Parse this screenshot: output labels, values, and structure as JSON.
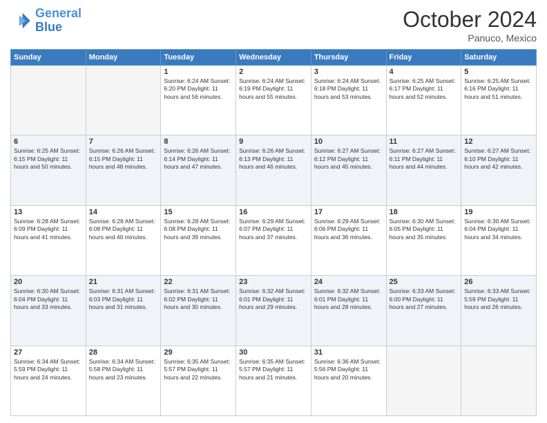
{
  "header": {
    "logo_line1": "General",
    "logo_line2": "Blue",
    "month": "October 2024",
    "location": "Panuco, Mexico"
  },
  "days_of_week": [
    "Sunday",
    "Monday",
    "Tuesday",
    "Wednesday",
    "Thursday",
    "Friday",
    "Saturday"
  ],
  "weeks": [
    [
      {
        "day": "",
        "info": ""
      },
      {
        "day": "",
        "info": ""
      },
      {
        "day": "1",
        "info": "Sunrise: 6:24 AM\nSunset: 6:20 PM\nDaylight: 11 hours and 56 minutes."
      },
      {
        "day": "2",
        "info": "Sunrise: 6:24 AM\nSunset: 6:19 PM\nDaylight: 11 hours and 55 minutes."
      },
      {
        "day": "3",
        "info": "Sunrise: 6:24 AM\nSunset: 6:18 PM\nDaylight: 11 hours and 53 minutes."
      },
      {
        "day": "4",
        "info": "Sunrise: 6:25 AM\nSunset: 6:17 PM\nDaylight: 11 hours and 52 minutes."
      },
      {
        "day": "5",
        "info": "Sunrise: 6:25 AM\nSunset: 6:16 PM\nDaylight: 11 hours and 51 minutes."
      }
    ],
    [
      {
        "day": "6",
        "info": "Sunrise: 6:25 AM\nSunset: 6:15 PM\nDaylight: 11 hours and 50 minutes."
      },
      {
        "day": "7",
        "info": "Sunrise: 6:26 AM\nSunset: 6:15 PM\nDaylight: 11 hours and 48 minutes."
      },
      {
        "day": "8",
        "info": "Sunrise: 6:26 AM\nSunset: 6:14 PM\nDaylight: 11 hours and 47 minutes."
      },
      {
        "day": "9",
        "info": "Sunrise: 6:26 AM\nSunset: 6:13 PM\nDaylight: 11 hours and 46 minutes."
      },
      {
        "day": "10",
        "info": "Sunrise: 6:27 AM\nSunset: 6:12 PM\nDaylight: 11 hours and 45 minutes."
      },
      {
        "day": "11",
        "info": "Sunrise: 6:27 AM\nSunset: 6:11 PM\nDaylight: 11 hours and 44 minutes."
      },
      {
        "day": "12",
        "info": "Sunrise: 6:27 AM\nSunset: 6:10 PM\nDaylight: 11 hours and 42 minutes."
      }
    ],
    [
      {
        "day": "13",
        "info": "Sunrise: 6:28 AM\nSunset: 6:09 PM\nDaylight: 11 hours and 41 minutes."
      },
      {
        "day": "14",
        "info": "Sunrise: 6:28 AM\nSunset: 6:08 PM\nDaylight: 11 hours and 40 minutes."
      },
      {
        "day": "15",
        "info": "Sunrise: 6:28 AM\nSunset: 6:08 PM\nDaylight: 11 hours and 39 minutes."
      },
      {
        "day": "16",
        "info": "Sunrise: 6:29 AM\nSunset: 6:07 PM\nDaylight: 11 hours and 37 minutes."
      },
      {
        "day": "17",
        "info": "Sunrise: 6:29 AM\nSunset: 6:06 PM\nDaylight: 11 hours and 36 minutes."
      },
      {
        "day": "18",
        "info": "Sunrise: 6:30 AM\nSunset: 6:05 PM\nDaylight: 11 hours and 35 minutes."
      },
      {
        "day": "19",
        "info": "Sunrise: 6:30 AM\nSunset: 6:04 PM\nDaylight: 11 hours and 34 minutes."
      }
    ],
    [
      {
        "day": "20",
        "info": "Sunrise: 6:30 AM\nSunset: 6:04 PM\nDaylight: 11 hours and 33 minutes."
      },
      {
        "day": "21",
        "info": "Sunrise: 6:31 AM\nSunset: 6:03 PM\nDaylight: 11 hours and 31 minutes."
      },
      {
        "day": "22",
        "info": "Sunrise: 6:31 AM\nSunset: 6:02 PM\nDaylight: 11 hours and 30 minutes."
      },
      {
        "day": "23",
        "info": "Sunrise: 6:32 AM\nSunset: 6:01 PM\nDaylight: 11 hours and 29 minutes."
      },
      {
        "day": "24",
        "info": "Sunrise: 6:32 AM\nSunset: 6:01 PM\nDaylight: 11 hours and 28 minutes."
      },
      {
        "day": "25",
        "info": "Sunrise: 6:33 AM\nSunset: 6:00 PM\nDaylight: 11 hours and 27 minutes."
      },
      {
        "day": "26",
        "info": "Sunrise: 6:33 AM\nSunset: 5:59 PM\nDaylight: 11 hours and 26 minutes."
      }
    ],
    [
      {
        "day": "27",
        "info": "Sunrise: 6:34 AM\nSunset: 5:59 PM\nDaylight: 11 hours and 24 minutes."
      },
      {
        "day": "28",
        "info": "Sunrise: 6:34 AM\nSunset: 5:58 PM\nDaylight: 11 hours and 23 minutes."
      },
      {
        "day": "29",
        "info": "Sunrise: 6:35 AM\nSunset: 5:57 PM\nDaylight: 11 hours and 22 minutes."
      },
      {
        "day": "30",
        "info": "Sunrise: 6:35 AM\nSunset: 5:57 PM\nDaylight: 11 hours and 21 minutes."
      },
      {
        "day": "31",
        "info": "Sunrise: 6:36 AM\nSunset: 5:56 PM\nDaylight: 11 hours and 20 minutes."
      },
      {
        "day": "",
        "info": ""
      },
      {
        "day": "",
        "info": ""
      }
    ]
  ]
}
